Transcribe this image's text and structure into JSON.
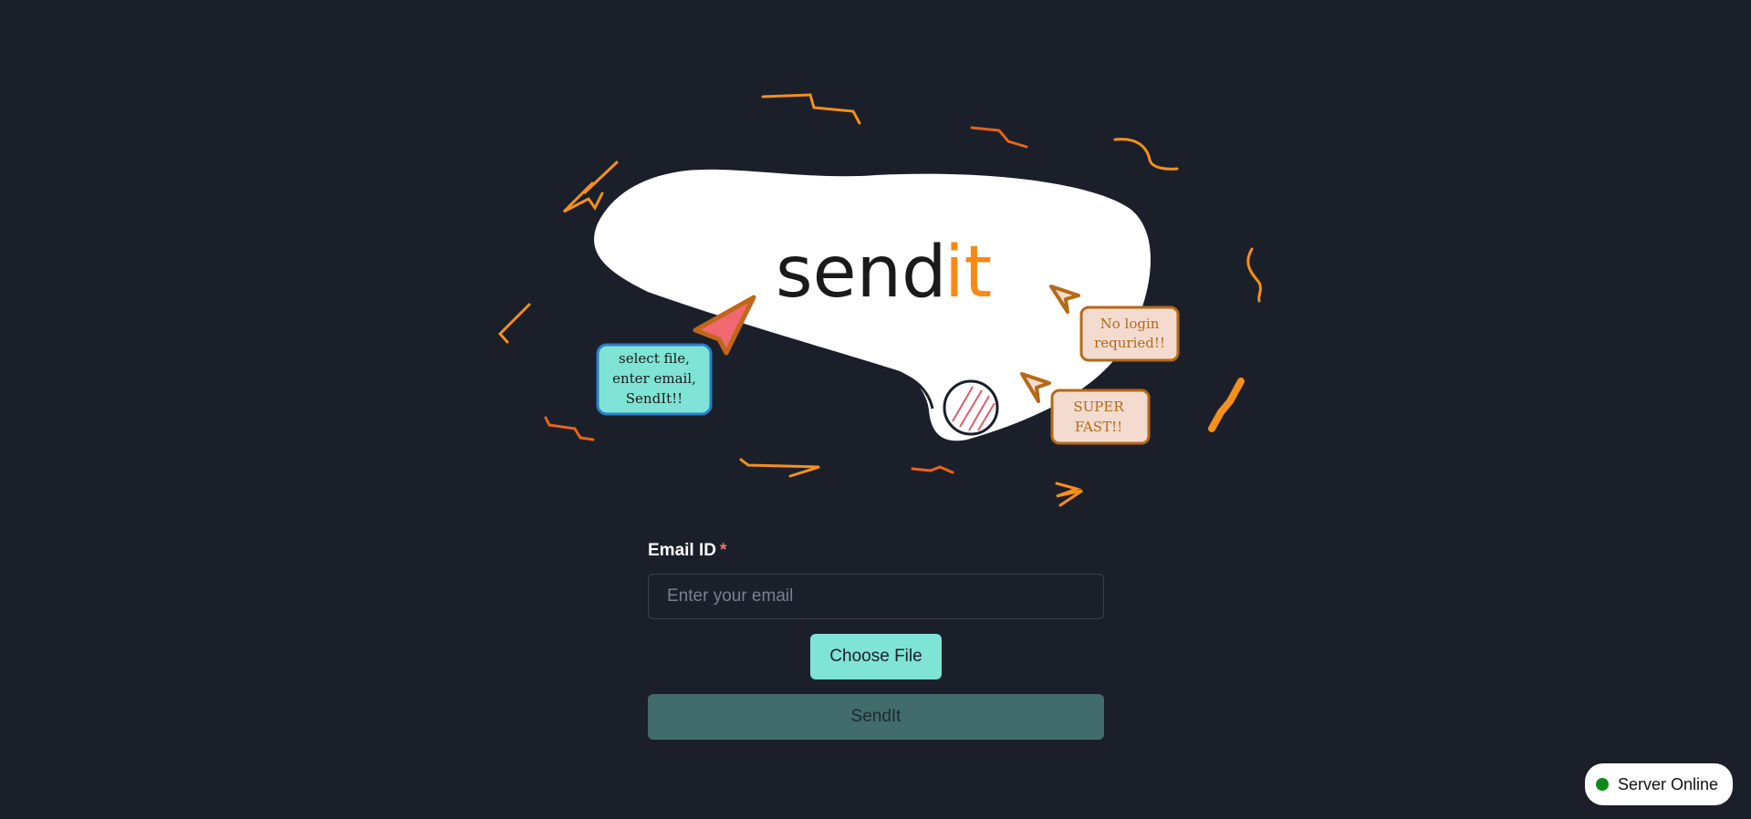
{
  "hero": {
    "logo_send": "send",
    "logo_it": "it",
    "bubble_select": [
      "select file,",
      "enter email,",
      "SendIt!!"
    ],
    "bubble_login": [
      "No login",
      "requried!!"
    ],
    "bubble_fast": [
      "SUPER",
      "FAST!!"
    ]
  },
  "form": {
    "email_label": "Email ID",
    "required_mark": "*",
    "email_placeholder": "Enter your email",
    "email_value": "",
    "choose_file_label": "Choose File",
    "send_label": "SendIt"
  },
  "status": {
    "text": "Server Online",
    "color": "#0f8a17"
  },
  "colors": {
    "background": "#1b1f2a",
    "accent": "#7fe3d6",
    "orange": "#f58a17",
    "send_button": "#426c6c"
  }
}
